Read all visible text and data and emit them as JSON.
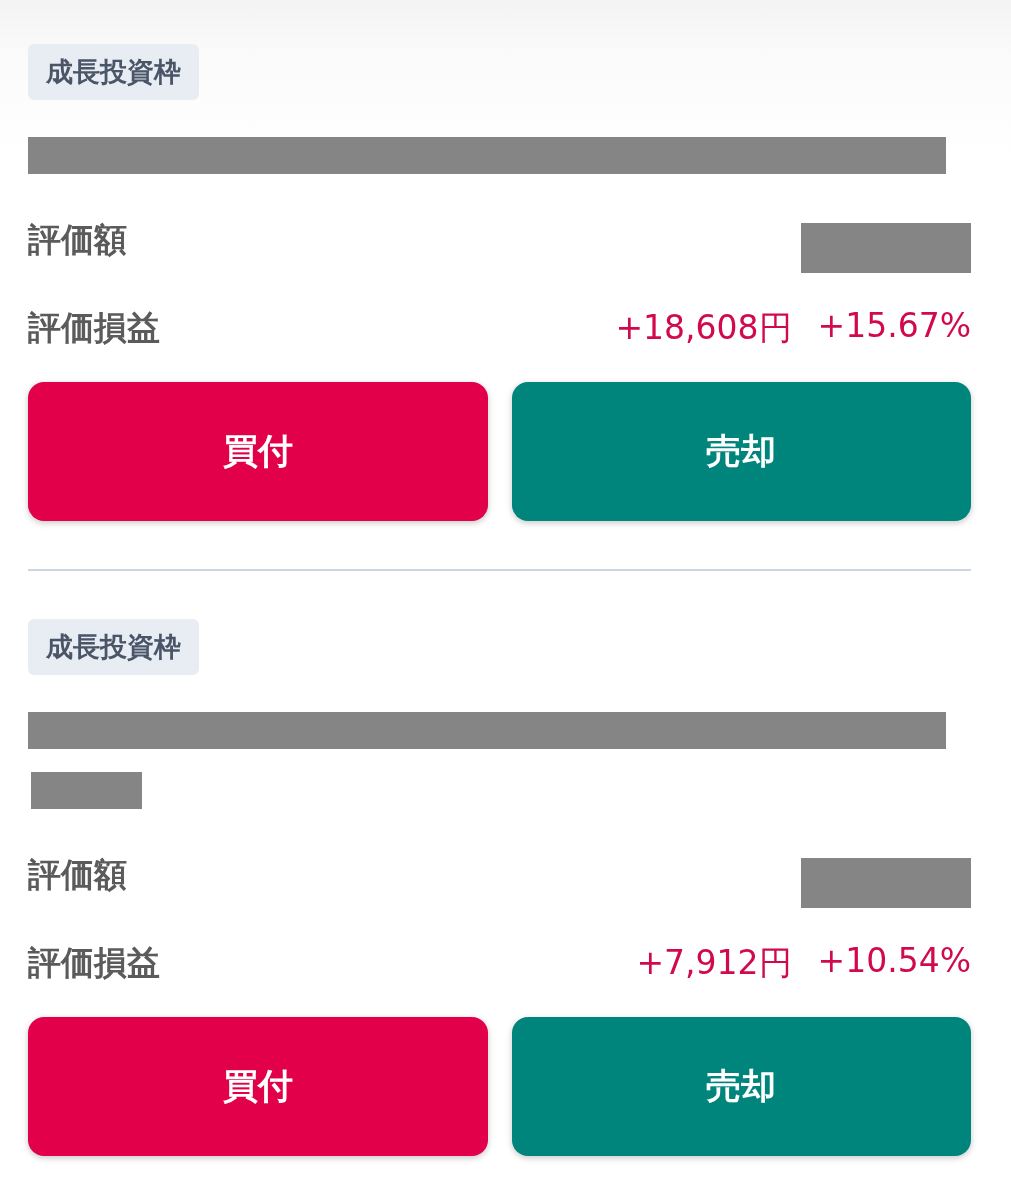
{
  "holdings": [
    {
      "badge": "成長投資枠",
      "name_redaction": [
        {
          "kind": "full"
        }
      ],
      "valuation": {
        "label": "評価額",
        "redacted": true
      },
      "profit_loss": {
        "label": "評価損益",
        "gain": true,
        "amount": "+18,608円",
        "percent": "+15.67%"
      },
      "buttons": [
        {
          "kind": "buy",
          "label": "買付"
        },
        {
          "kind": "sell",
          "label": "売却"
        }
      ]
    },
    {
      "badge": "成長投資枠",
      "name_redaction": [
        {
          "kind": "full"
        },
        {
          "kind": "short"
        }
      ],
      "valuation": {
        "label": "評価額",
        "redacted": true
      },
      "profit_loss": {
        "label": "評価損益",
        "gain": true,
        "amount": "+7,912円",
        "percent": "+10.54%"
      },
      "buttons": [
        {
          "kind": "buy",
          "label": "買付"
        },
        {
          "kind": "sell",
          "label": "売却"
        }
      ]
    }
  ]
}
